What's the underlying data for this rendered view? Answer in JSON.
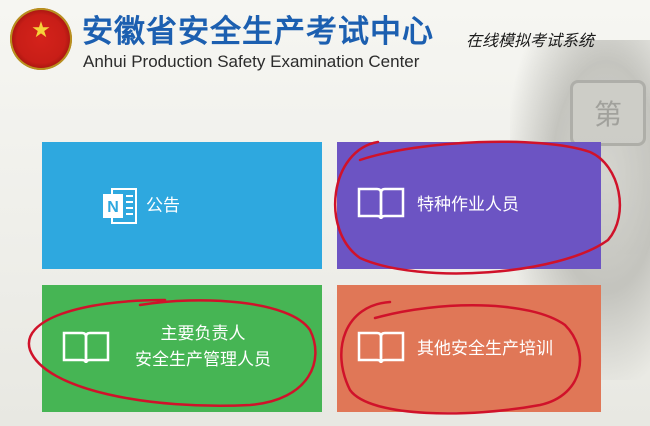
{
  "header": {
    "title_cn": "安徽省安全生产考试中心",
    "title_en": "Anhui Production Safety Examination Center",
    "subtitle": "在线模拟考试系统"
  },
  "background": {
    "plate_text": "第"
  },
  "tiles": {
    "notice": {
      "label": "公告",
      "color": "#2ea8df"
    },
    "special": {
      "label": "特种作业人员",
      "color": "#6c54c3"
    },
    "principal": {
      "line1": "主要负责人",
      "line2": "安全生产管理人员",
      "color": "#46b554"
    },
    "other": {
      "label": "其他安全生产培训",
      "color": "#e07757"
    }
  },
  "icons": {
    "emblem": "national-emblem-icon",
    "notice": "onenote-icon",
    "book": "open-book-icon"
  }
}
